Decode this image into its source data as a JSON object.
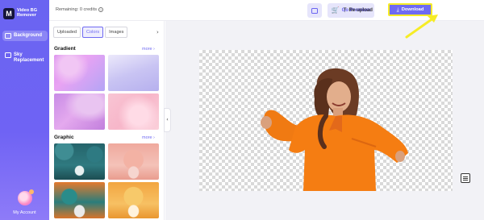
{
  "app": {
    "logo_mark": "M",
    "logo_text": "Video BG Remover"
  },
  "rail": {
    "items": [
      {
        "label": "Background",
        "active": true
      },
      {
        "label": "Sky Replacement",
        "active": false
      }
    ],
    "account_label": "My Account"
  },
  "topbar": {
    "credits_text": "Remaining: 0 credits",
    "help_symbol": "?",
    "go_premium_label": "Go Premium",
    "reupload_label": "Re-upload",
    "download_label": "Download"
  },
  "panel": {
    "tabs": [
      {
        "label": "Uploaded",
        "selected": false
      },
      {
        "label": "Colors",
        "selected": true
      },
      {
        "label": "Images",
        "selected": false
      }
    ],
    "sections": [
      {
        "title": "Gradient",
        "more_label": "more ›"
      },
      {
        "title": "Graphic",
        "more_label": "more ›"
      }
    ]
  },
  "icons": {
    "upload_square": "image-upload-icon",
    "cart": "cart-icon",
    "more_vert": "more-vertical-icon",
    "reupload": "upload-arrow-icon",
    "download": "download-arrow-icon",
    "collapse": "chevron-left-icon",
    "tab_next": "chevron-right-icon",
    "feedback": "feedback-icon"
  },
  "colors": {
    "accent": "#6f6af2",
    "rail": "#6a64f1",
    "highlight": "#f6ec26"
  }
}
